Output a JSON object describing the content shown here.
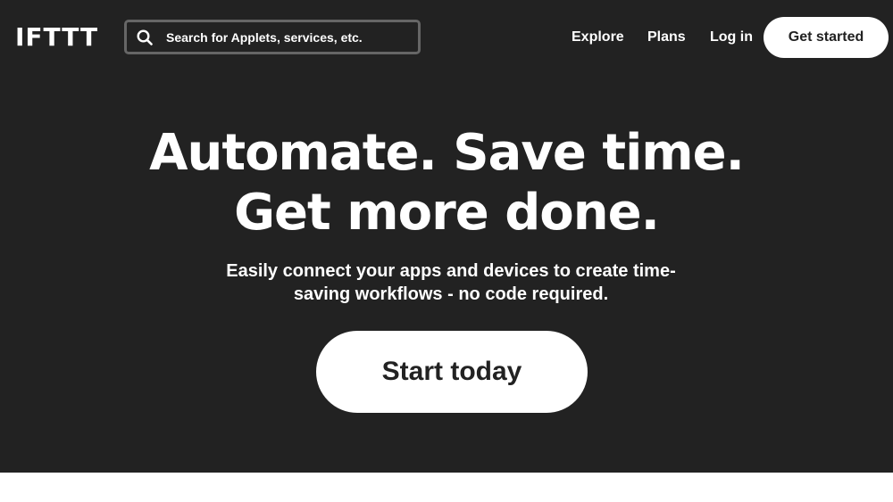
{
  "header": {
    "logo_text": "IFTTT",
    "search": {
      "placeholder": "Search for Applets, services, etc.",
      "icon": "search-icon"
    },
    "nav": {
      "explore": "Explore",
      "plans": "Plans",
      "login": "Log in"
    },
    "cta_label": "Get started"
  },
  "hero": {
    "headline_line1": "Automate. Save time.",
    "headline_line2": "Get more done.",
    "subtitle": "Easily connect your apps and devices to create time-saving workflows - no code required.",
    "cta_label": "Start today"
  },
  "colors": {
    "hero_background": "#222222",
    "text": "#ffffff",
    "button_background": "#ffffff",
    "button_text": "#222222",
    "search_border": "#666666"
  }
}
